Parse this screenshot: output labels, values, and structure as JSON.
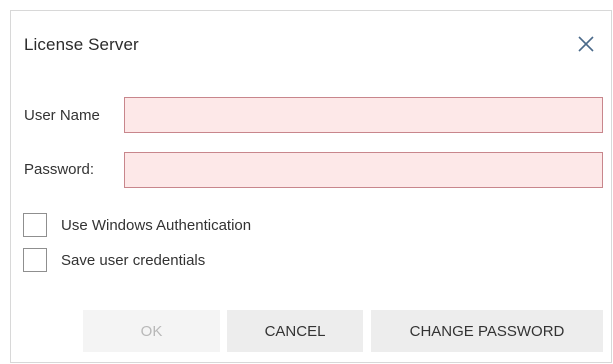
{
  "dialog": {
    "title": "License Server",
    "close_icon": "close-icon"
  },
  "form": {
    "username_label": "User Name",
    "username_value": "",
    "password_label": "Password:",
    "password_value": "",
    "input_invalid_bg": "#fde8e8",
    "input_invalid_border": "#c8868c"
  },
  "options": {
    "windows_auth_label": "Use Windows Authentication",
    "windows_auth_checked": false,
    "save_credentials_label": "Save user credentials",
    "save_credentials_checked": false
  },
  "buttons": {
    "ok_label": "OK",
    "ok_enabled": false,
    "cancel_label": "CANCEL",
    "change_password_label": "CHANGE PASSWORD"
  }
}
